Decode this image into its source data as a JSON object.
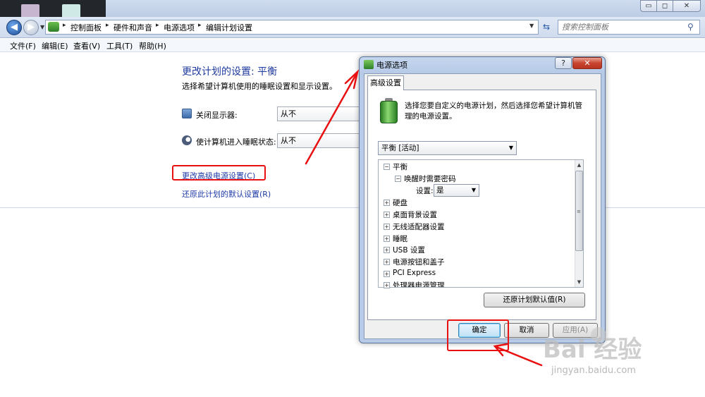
{
  "window": {
    "controls": {
      "minimize": "▭",
      "maximize": "◻",
      "close": "✕"
    }
  },
  "address": {
    "breadcrumbs": [
      "控制面板",
      "硬件和声音",
      "电源选项",
      "编辑计划设置"
    ],
    "search_placeholder": "搜索控制面板"
  },
  "menu": [
    "文件(F)",
    "编辑(E)",
    "查看(V)",
    "工具(T)",
    "帮助(H)"
  ],
  "main": {
    "title": "更改计划的设置: 平衡",
    "subtitle": "选择希望计算机使用的睡眠设置和显示设置。",
    "rows": [
      {
        "label": "关闭显示器:",
        "value": "从不"
      },
      {
        "label": "使计算机进入睡眠状态:",
        "value": "从不"
      }
    ],
    "advanced_link": "更改高级电源设置(C)",
    "restore_link": "还原此计划的默认设置(R)"
  },
  "dialog": {
    "title": "电源选项",
    "help": "?",
    "close": "✕",
    "tab": "高级设置",
    "intro": "选择您要自定义的电源计划，然后选择您希望计算机管理的电源设置。",
    "plan_select": "平衡 [活动]",
    "tree": {
      "root": "平衡",
      "child": "唤醒时需要密码",
      "setting_label": "设置:",
      "setting_value": "是",
      "items": [
        "硬盘",
        "桌面背景设置",
        "无线适配器设置",
        "睡眠",
        "USB 设置",
        "电源按钮和盖子",
        "PCI Express",
        "处理器电源管理"
      ]
    },
    "restore_button": "还原计划默认值(R)",
    "ok_button": "确定",
    "cancel_button": "取消",
    "apply_button": "应用(A)"
  },
  "watermark": {
    "brand": "Bai  经验",
    "url": "jingyan.baidu.com"
  },
  "colors": {
    "link": "#1e3aa8",
    "annotation": "#e81010",
    "title_blue": "#1e3a9e"
  }
}
